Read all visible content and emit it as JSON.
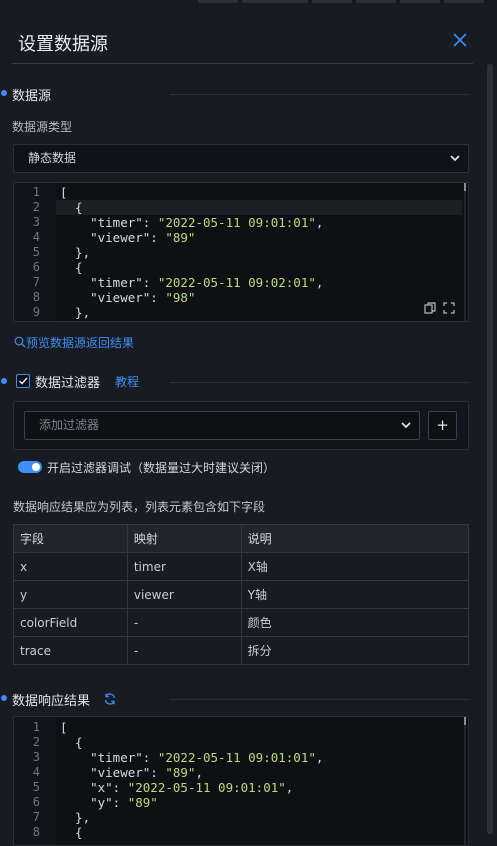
{
  "header": {
    "title": "设置数据源"
  },
  "datasource_section": {
    "title": "数据源",
    "type_label": "数据源类型",
    "type_value": "静态数据",
    "editor": {
      "line_numbers": [
        "1",
        "2",
        "3",
        "4",
        "5",
        "6",
        "7",
        "8",
        "9"
      ],
      "lines": [
        {
          "pre": "[",
          "key": "",
          "mid": "",
          "val": "",
          "post": ""
        },
        {
          "pre": "  {",
          "key": "",
          "mid": "",
          "val": "",
          "post": ""
        },
        {
          "pre": "    ",
          "key": "\"timer\"",
          "mid": ": ",
          "val": "\"2022-05-11 09:01:01\"",
          "post": ","
        },
        {
          "pre": "    ",
          "key": "\"viewer\"",
          "mid": ": ",
          "val": "\"89\"",
          "post": ""
        },
        {
          "pre": "  },",
          "key": "",
          "mid": "",
          "val": "",
          "post": ""
        },
        {
          "pre": "  {",
          "key": "",
          "mid": "",
          "val": "",
          "post": ""
        },
        {
          "pre": "    ",
          "key": "\"timer\"",
          "mid": ": ",
          "val": "\"2022-05-11 09:02:01\"",
          "post": ","
        },
        {
          "pre": "    ",
          "key": "\"viewer\"",
          "mid": ": ",
          "val": "\"98\"",
          "post": ""
        },
        {
          "pre": "  },",
          "key": "",
          "mid": "",
          "val": "",
          "post": ""
        }
      ]
    },
    "preview_link": "预览数据源返回结果"
  },
  "filter_section": {
    "title": "数据过滤器",
    "tutorial_link": "教程",
    "add_filter_placeholder": "添加过滤器",
    "add_button": "+",
    "debug_toggle_label": "开启过滤器调试（数据量过大时建议关闭）"
  },
  "fields_table": {
    "intro": "数据响应结果应为列表，列表元素包含如下字段",
    "headers": [
      "字段",
      "映射",
      "说明"
    ],
    "rows": [
      [
        "x",
        "timer",
        "X轴"
      ],
      [
        "y",
        "viewer",
        "Y轴"
      ],
      [
        "colorField",
        "-",
        "颜色"
      ],
      [
        "trace",
        "-",
        "拆分"
      ]
    ]
  },
  "response_section": {
    "title": "数据响应结果",
    "editor": {
      "line_numbers": [
        "1",
        "2",
        "3",
        "4",
        "5",
        "6",
        "7",
        "8"
      ],
      "lines": [
        {
          "pre": "[",
          "key": "",
          "mid": "",
          "val": "",
          "post": ""
        },
        {
          "pre": "  {",
          "key": "",
          "mid": "",
          "val": "",
          "post": ""
        },
        {
          "pre": "    ",
          "key": "\"timer\"",
          "mid": ": ",
          "val": "\"2022-05-11 09:01:01\"",
          "post": ","
        },
        {
          "pre": "    ",
          "key": "\"viewer\"",
          "mid": ": ",
          "val": "\"89\"",
          "post": ","
        },
        {
          "pre": "    ",
          "key": "\"x\"",
          "mid": ": ",
          "val": "\"2022-05-11 09:01:01\"",
          "post": ","
        },
        {
          "pre": "    ",
          "key": "\"y\"",
          "mid": ": ",
          "val": "\"89\"",
          "post": ""
        },
        {
          "pre": "  },",
          "key": "",
          "mid": "",
          "val": "",
          "post": ""
        },
        {
          "pre": "  {",
          "key": "",
          "mid": "",
          "val": "",
          "post": ""
        }
      ]
    }
  },
  "colors": {
    "accent": "#3d8ef5",
    "string": "#b8dd7e",
    "panel_bg": "#181b21"
  }
}
